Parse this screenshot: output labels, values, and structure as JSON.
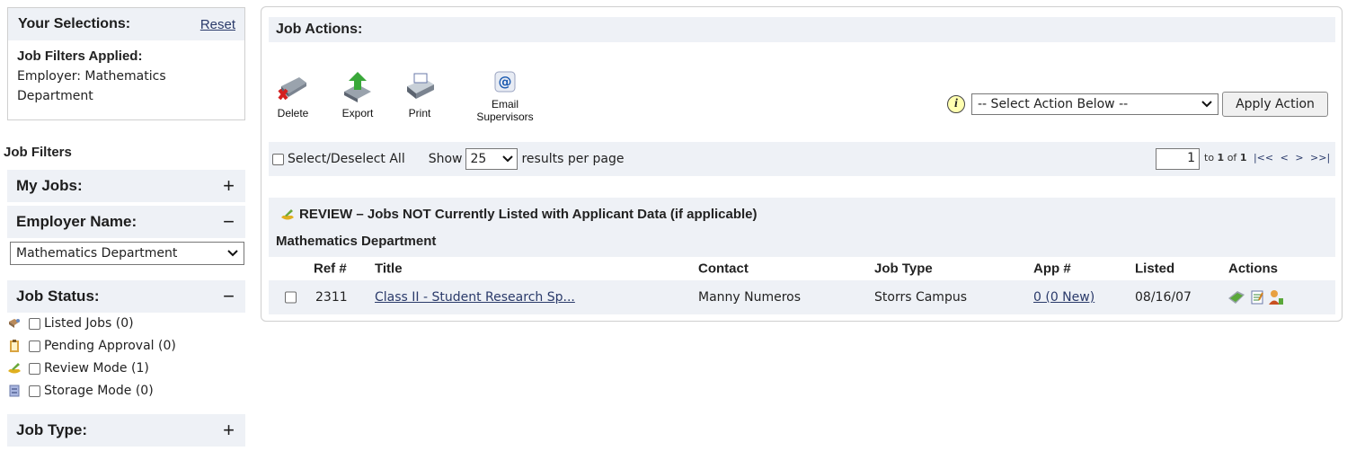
{
  "selections": {
    "title": "Your Selections:",
    "reset_label": "Reset",
    "applied_label": "Job Filters Applied:",
    "applied_line1": "Employer: Mathematics",
    "applied_line2": "Department"
  },
  "filters": {
    "title": "Job Filters",
    "my_jobs": {
      "label": "My Jobs:",
      "symbol": "+"
    },
    "employer": {
      "label": "Employer Name:",
      "symbol": "−",
      "selected": "Mathematics Department"
    },
    "status": {
      "label": "Job Status:",
      "symbol": "−",
      "items": [
        {
          "label": "Listed Jobs (0)",
          "icon": "listed-icon"
        },
        {
          "label": "Pending Approval (0)",
          "icon": "clipboard-icon"
        },
        {
          "label": "Review Mode (1)",
          "icon": "review-icon"
        },
        {
          "label": "Storage Mode (0)",
          "icon": "storage-icon"
        }
      ]
    },
    "job_type": {
      "label": "Job Type:",
      "symbol": "+"
    }
  },
  "actions": {
    "header": "Job Actions:",
    "tools": [
      {
        "label": "Delete",
        "icon": "delete-icon"
      },
      {
        "label": "Export",
        "icon": "export-icon"
      },
      {
        "label": "Print",
        "icon": "print-icon"
      },
      {
        "label": "Email Supervisors",
        "icon": "email-icon"
      }
    ],
    "info_icon_glyph": "i",
    "select_value": "-- Select Action Below --",
    "apply_label": "Apply Action"
  },
  "pager": {
    "select_all_label": "Select/Deselect All",
    "show_label": "Show",
    "per_page": "25",
    "results_label": "results per page",
    "page_value": "1",
    "to_label": "to",
    "range_from": "1",
    "of_label": "of",
    "range_total": "1",
    "nav_first": "|<<",
    "nav_prev": "<",
    "nav_next": ">",
    "nav_last": ">>|"
  },
  "group": {
    "title": "REVIEW – Jobs NOT Currently Listed with Applicant Data (if applicable)",
    "subheading": "Mathematics Department",
    "columns": [
      "Ref #",
      "Title",
      "Contact",
      "Job Type",
      "App #",
      "Listed",
      "Actions"
    ],
    "rows": [
      {
        "ref": "2311",
        "title": "Class II - Student Research Sp...",
        "contact": "Manny Numeros",
        "job_type": "Storrs Campus",
        "app": "0 (0 New)",
        "listed": "08/16/07"
      }
    ]
  }
}
